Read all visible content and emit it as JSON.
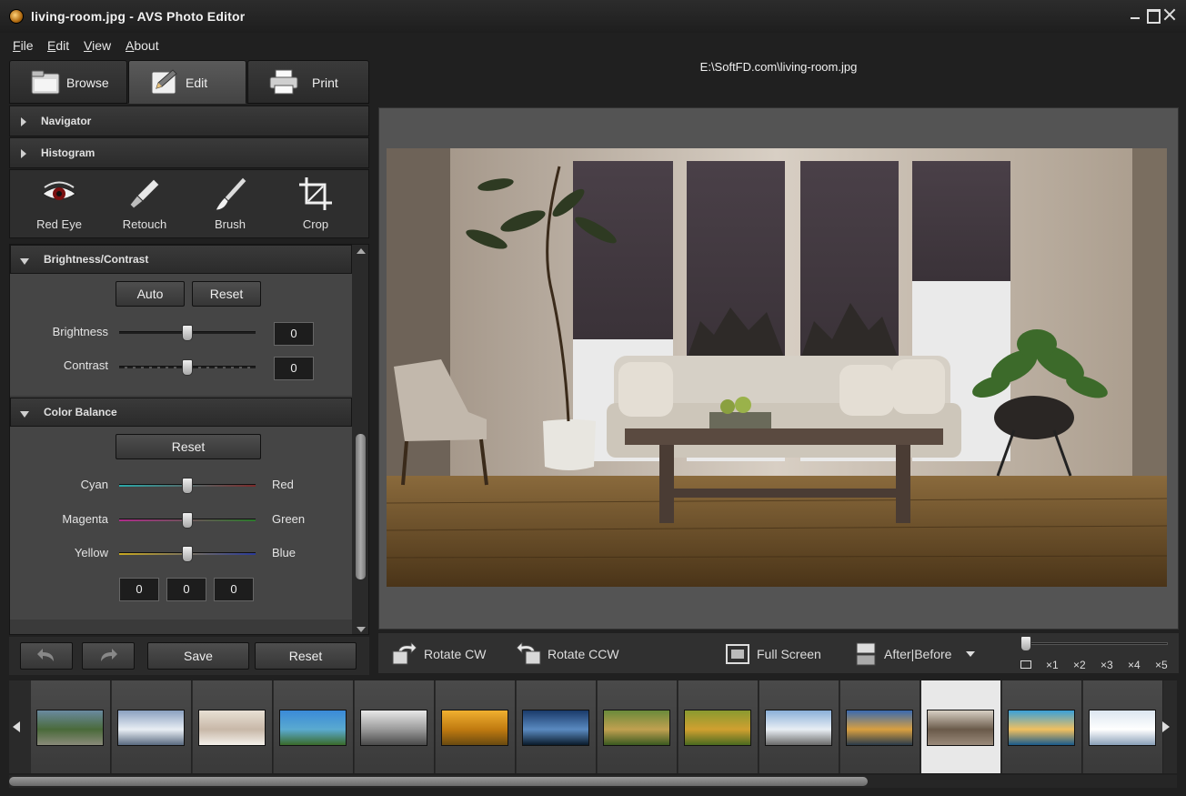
{
  "window": {
    "title": "living-room.jpg  -  AVS Photo Editor"
  },
  "menu": [
    {
      "label": "File"
    },
    {
      "label": "Edit"
    },
    {
      "label": "View"
    },
    {
      "label": "About"
    }
  ],
  "tabs": [
    {
      "label": "Browse",
      "icon": "folder-icon"
    },
    {
      "label": "Edit",
      "icon": "edit-icon"
    },
    {
      "label": "Print",
      "icon": "printer-icon"
    }
  ],
  "sections": {
    "navigator": "Navigator",
    "histogram": "Histogram",
    "brightness_contrast": "Brightness/Contrast",
    "color_balance": "Color Balance"
  },
  "tools": [
    {
      "label": "Red Eye",
      "icon": "red-eye-icon"
    },
    {
      "label": "Retouch",
      "icon": "retouch-icon"
    },
    {
      "label": "Brush",
      "icon": "brush-icon"
    },
    {
      "label": "Crop",
      "icon": "crop-icon"
    }
  ],
  "brightness_contrast": {
    "auto_label": "Auto",
    "reset_label": "Reset",
    "brightness_label": "Brightness",
    "brightness_value": "0",
    "contrast_label": "Contrast",
    "contrast_value": "0"
  },
  "color_balance": {
    "reset_label": "Reset",
    "cyan_label": "Cyan",
    "red_label": "Red",
    "magenta_label": "Magenta",
    "green_label": "Green",
    "yellow_label": "Yellow",
    "blue_label": "Blue",
    "values": [
      "0",
      "0",
      "0"
    ]
  },
  "footer": {
    "save_label": "Save",
    "reset_label": "Reset"
  },
  "viewer": {
    "path": "E:\\SoftFD.com\\living-room.jpg"
  },
  "viewer_toolbar": {
    "rotate_cw": "Rotate CW",
    "rotate_ccw": "Rotate CCW",
    "full_screen": "Full Screen",
    "after_before": "After|Before",
    "zoom_levels": [
      "×1",
      "×2",
      "×3",
      "×4",
      "×5"
    ]
  },
  "filmstrip": {
    "selected_index": 11,
    "thumbnails": [
      {
        "name": "lake-landscape"
      },
      {
        "name": "snowy-mountains"
      },
      {
        "name": "light-texture"
      },
      {
        "name": "coastal-castle"
      },
      {
        "name": "white-interior"
      },
      {
        "name": "autumn-tree"
      },
      {
        "name": "blue-wave"
      },
      {
        "name": "green-valley"
      },
      {
        "name": "autumn-forest"
      },
      {
        "name": "winter-road"
      },
      {
        "name": "lake-sunset"
      },
      {
        "name": "living-room"
      },
      {
        "name": "resort-pool"
      },
      {
        "name": "snow-scene"
      }
    ]
  },
  "colors": {
    "accent_selected": "#e8e8e8",
    "panel_bg": "#454545",
    "viewer_bg": "#545454"
  }
}
